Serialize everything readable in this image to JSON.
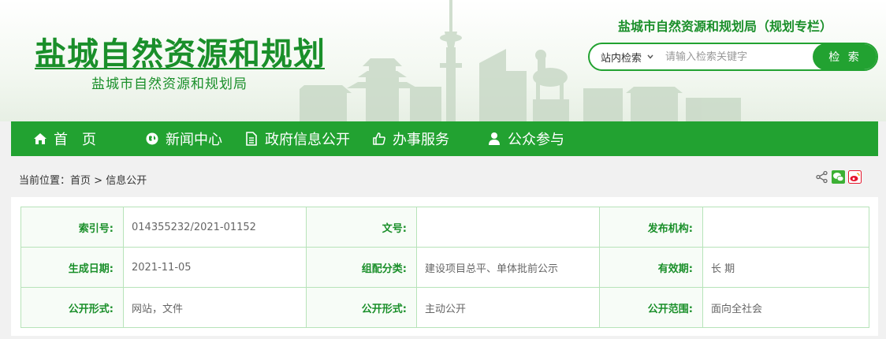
{
  "header": {
    "logo_title": "盐城自然资源和规划",
    "logo_subtitle": "盐城市自然资源和规划局",
    "column_title": "盐城市自然资源和规划局（规划专栏）",
    "search": {
      "scope": "站内检索",
      "placeholder": "请输入检索关键字",
      "button": "检 索"
    }
  },
  "nav": {
    "items": [
      {
        "label": "首　页",
        "icon": "home-icon"
      },
      {
        "label": "新闻中心",
        "icon": "globe-icon"
      },
      {
        "label": "政府信息公开",
        "icon": "document-icon"
      },
      {
        "label": "办事服务",
        "icon": "thumbs-up-icon"
      },
      {
        "label": "公众参与",
        "icon": "user-icon"
      }
    ]
  },
  "breadcrumb": {
    "prefix": "当前位置：",
    "home": "首页",
    "separator": " > ",
    "current": "信息公开"
  },
  "share": [
    "share-icon",
    "wechat-icon",
    "weibo-icon"
  ],
  "info_table": {
    "rows": [
      [
        {
          "label": "索引号:",
          "value": "014355232/2021-01152"
        },
        {
          "label": "文号:",
          "value": ""
        },
        {
          "label": "发布机构:",
          "value": ""
        }
      ],
      [
        {
          "label": "生成日期:",
          "value": "2021-11-05"
        },
        {
          "label": "组配分类:",
          "value": "建设项目总平、单体批前公示"
        },
        {
          "label": "有效期:",
          "value": "长 期"
        }
      ],
      [
        {
          "label": "公开形式:",
          "value": "网站，文件"
        },
        {
          "label": "公开形式:",
          "value": "主动公开"
        },
        {
          "label": "公开范围:",
          "value": "面向全社会"
        }
      ]
    ]
  },
  "colors": {
    "brand_green": "#22a231",
    "title_green": "#1a8f2a",
    "table_border": "#b7e3b9"
  }
}
